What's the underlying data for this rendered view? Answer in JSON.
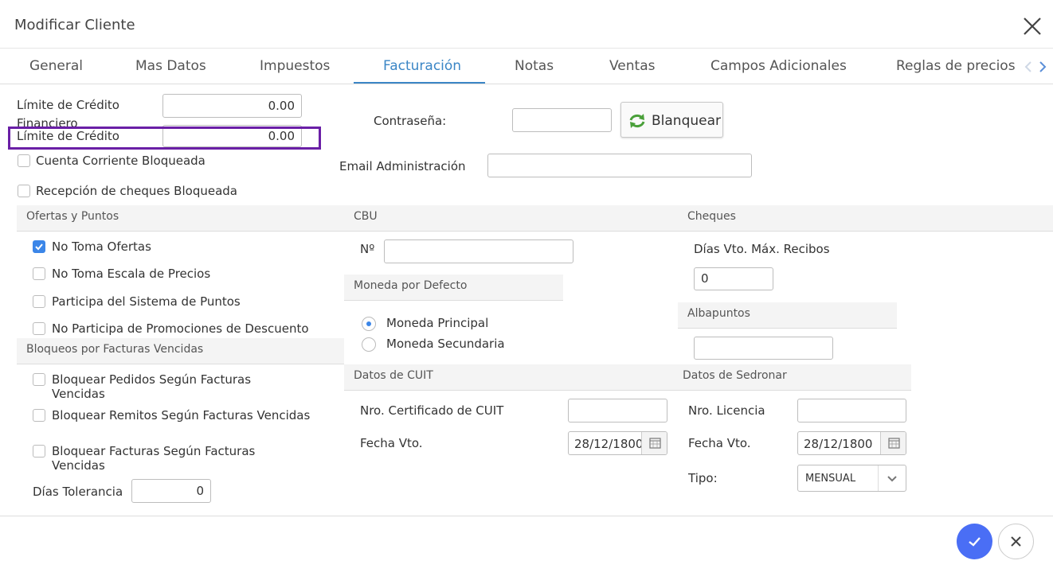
{
  "dialog": {
    "title": "Modificar Cliente"
  },
  "tabs": [
    {
      "label": "General"
    },
    {
      "label": "Mas Datos"
    },
    {
      "label": "Impuestos"
    },
    {
      "label": "Facturación"
    },
    {
      "label": "Notas"
    },
    {
      "label": "Ventas"
    },
    {
      "label": "Campos Adicionales"
    },
    {
      "label": "Reglas de precios"
    }
  ],
  "active_tab": "Facturación",
  "credit": {
    "limite_financiero_label": "Límite de Crédito Financiero",
    "limite_financiero_value": "0.00",
    "limite_label": "Límite de Crédito",
    "limite_value": "0.00",
    "cuenta_bloqueada_label": "Cuenta Corriente Bloqueada",
    "cheques_bloqueada_label": "Recepción de cheques Bloqueada"
  },
  "password": {
    "label": "Contraseña:",
    "value": "",
    "button": "Blanquear"
  },
  "email_admin": {
    "label": "Email Administración",
    "value": ""
  },
  "ofertas": {
    "header": "Ofertas y Puntos",
    "items": [
      {
        "label": "No Toma Ofertas",
        "checked": true
      },
      {
        "label": "No Toma Escala de Precios",
        "checked": false
      },
      {
        "label": "Participa del Sistema de Puntos",
        "checked": false
      },
      {
        "label": "No Participa de Promociones de Descuento",
        "checked": false
      }
    ]
  },
  "bloqueos": {
    "header": "Bloqueos por Facturas Vencidas",
    "items": [
      {
        "label": "Bloquear Pedidos Según Facturas Vencidas",
        "checked": false
      },
      {
        "label": "Bloquear Remitos Según Facturas Vencidas",
        "checked": false
      },
      {
        "label": "Bloquear Facturas Según Facturas Vencidas",
        "checked": false
      }
    ],
    "tolerancia_label": "Días Tolerancia",
    "tolerancia_value": "0"
  },
  "cbu": {
    "header": "CBU",
    "nro_label": "Nº",
    "nro_value": ""
  },
  "moneda": {
    "header": "Moneda por Defecto",
    "options": [
      {
        "label": "Moneda Principal",
        "selected": true
      },
      {
        "label": "Moneda Secundaria",
        "selected": false
      }
    ]
  },
  "cuit": {
    "header": "Datos de CUIT",
    "cert_label": "Nro. Certificado de CUIT",
    "cert_value": "",
    "fecha_label": "Fecha Vto.",
    "fecha_value": "28/12/1800"
  },
  "cheques": {
    "header": "Cheques",
    "dias_label": "Días Vto. Máx. Recibos",
    "dias_value": "0"
  },
  "albapuntos": {
    "header": "Albapuntos",
    "value": ""
  },
  "sedronar": {
    "header": "Datos de Sedronar",
    "licencia_label": "Nro. Licencia",
    "licencia_value": "",
    "fecha_label": "Fecha Vto.",
    "fecha_value": "28/12/1800",
    "tipo_label": "Tipo:",
    "tipo_value": "MENSUAL"
  },
  "colors": {
    "accent": "#3b86c6",
    "ok_button": "#4a6ef5",
    "highlight": "#6a1fa6",
    "checkbox_on": "#3b86e8"
  },
  "icons": [
    "close-icon",
    "refresh-icon",
    "calendar-icon",
    "chevron-down-icon",
    "check-icon",
    "chevron-left-icon",
    "chevron-right-icon"
  ]
}
